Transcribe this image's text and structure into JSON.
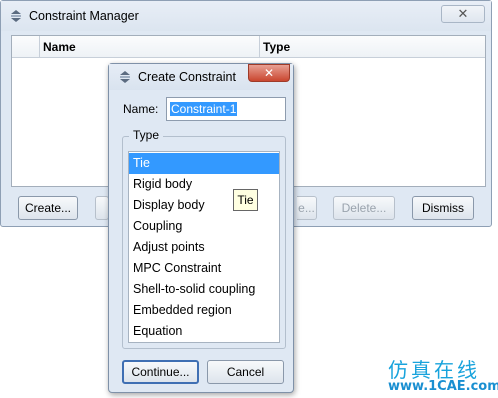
{
  "constraint_manager": {
    "title": "Constraint Manager",
    "close_glyph": "✕",
    "columns": [
      "Name",
      "Type"
    ],
    "buttons": {
      "create": "Create...",
      "edit": "",
      "copy": "",
      "rename": "e...",
      "delete": "Delete...",
      "dismiss": "Dismiss"
    }
  },
  "create_constraint": {
    "title": "Create Constraint",
    "close_glyph": "✕",
    "name_label": "Name:",
    "name_value": "Constraint-1",
    "type_legend": "Type",
    "types": [
      "Tie",
      "Rigid body",
      "Display body",
      "Coupling",
      "Adjust points",
      "MPC Constraint",
      "Shell-to-solid coupling",
      "Embedded region",
      "Equation"
    ],
    "selected_type": "Tie",
    "tooltip": "Tie",
    "buttons": {
      "continue": "Continue...",
      "cancel": "Cancel"
    }
  },
  "watermark": {
    "chinese": "仿真在线",
    "url": "www.1CAE.com"
  },
  "colors": {
    "selection": "#3399ff",
    "window_bg": "#dfe8f3",
    "close_red": "#c9462f",
    "watermark": "#18a3dc"
  },
  "icons": {
    "window_icon": "abaqus-window-icon"
  }
}
